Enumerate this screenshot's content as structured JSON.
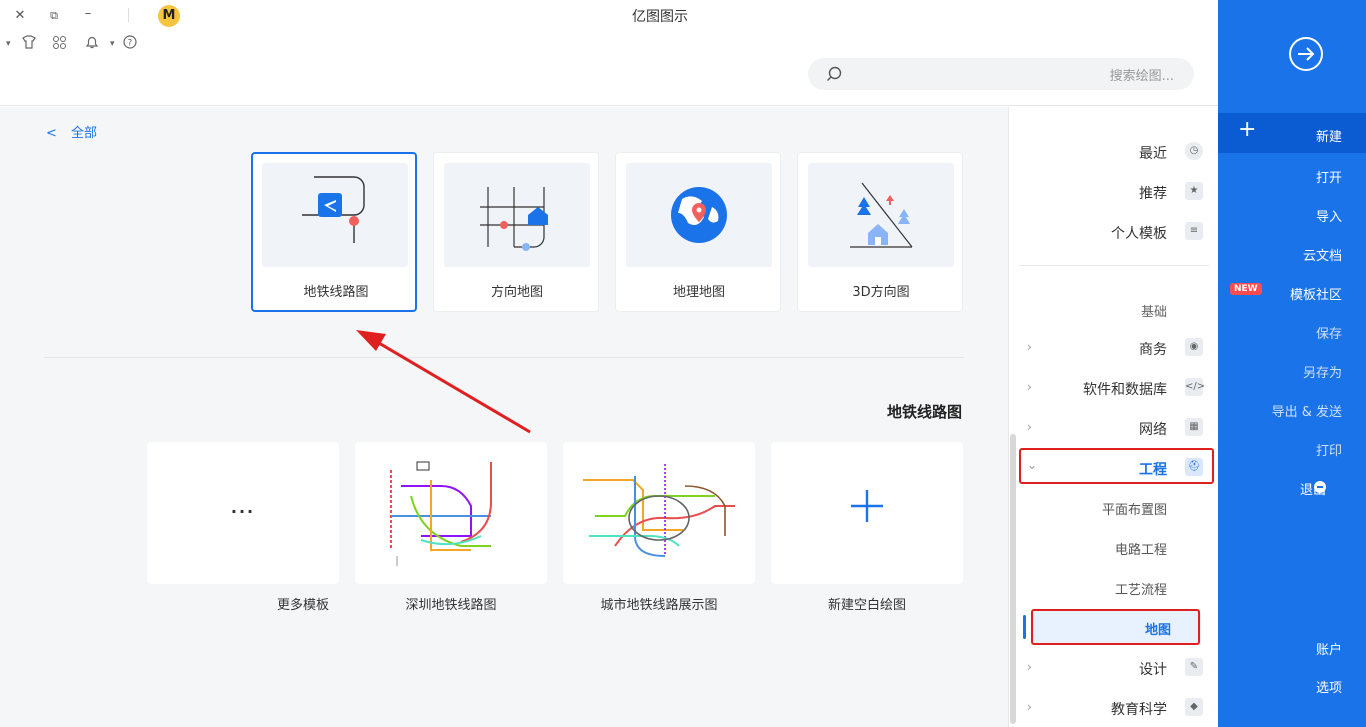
{
  "app": {
    "title": "亿图图示",
    "logo_letter": "M"
  },
  "window_controls": {
    "close": "✕",
    "restore": "⧉",
    "minimize": "–"
  },
  "toolbar_icons": [
    "shirt-icon",
    "apps-icon",
    "bell-icon",
    "help-icon"
  ],
  "search": {
    "placeholder": "搜索绘图..."
  },
  "right_nav": {
    "items": [
      {
        "label": "新建",
        "icon": "+"
      },
      {
        "label": "打开"
      },
      {
        "label": "导入"
      },
      {
        "label": "云文档"
      },
      {
        "label": "模板社区",
        "badge": "NEW"
      },
      {
        "label": "保存"
      },
      {
        "label": "另存为"
      },
      {
        "label": "导出 & 发送"
      },
      {
        "label": "打印"
      },
      {
        "label": "退出"
      }
    ],
    "bottom": [
      {
        "label": "账户"
      },
      {
        "label": "选项"
      }
    ]
  },
  "categories": {
    "top": [
      {
        "label": "最近"
      },
      {
        "label": "推荐"
      },
      {
        "label": "个人模板"
      }
    ],
    "section_title": "基础",
    "items": [
      {
        "label": "商务"
      },
      {
        "label": "软件和数据库"
      },
      {
        "label": "网络"
      },
      {
        "label": "工程"
      },
      {
        "label": "平面布置图"
      },
      {
        "label": "电路工程"
      },
      {
        "label": "工艺流程"
      },
      {
        "label": "地图"
      },
      {
        "label": "设计"
      },
      {
        "label": "教育科学"
      }
    ]
  },
  "breadcrumb": {
    "back": "<",
    "label": "全部"
  },
  "type_cards": [
    {
      "label": "地铁线路图"
    },
    {
      "label": "方向地图"
    },
    {
      "label": "地理地图"
    },
    {
      "label": "3D方向图"
    }
  ],
  "section": {
    "title": "地铁线路图"
  },
  "templates": [
    {
      "label": "新建空白绘图",
      "symbol": "+"
    },
    {
      "label": "城市地铁线路展示图"
    },
    {
      "label": "深圳地铁线路图"
    },
    {
      "label": "更多模板",
      "symbol": "..."
    }
  ],
  "colors": {
    "accent": "#1a73e8",
    "nav_bg": "#1a73e8",
    "annotation": "#e02020"
  }
}
